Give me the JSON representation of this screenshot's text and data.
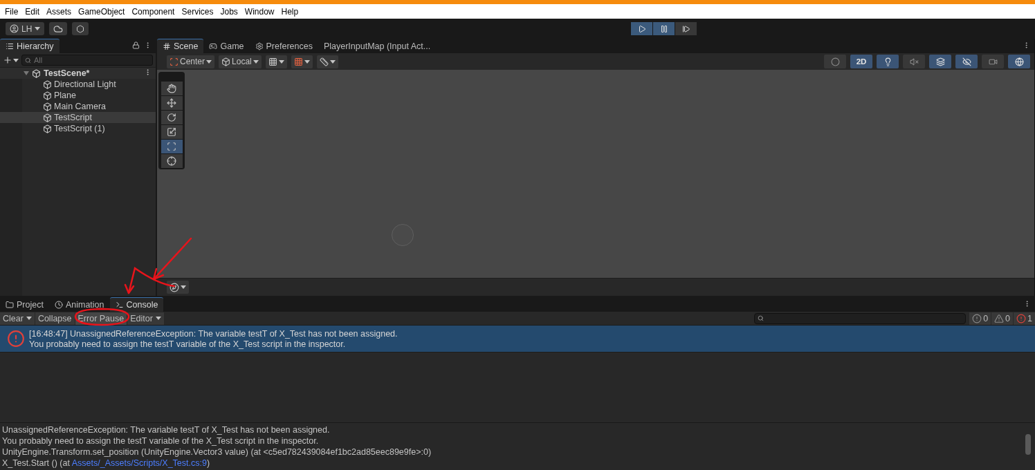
{
  "menu_bar": [
    "File",
    "Edit",
    "Assets",
    "GameObject",
    "Component",
    "Services",
    "Jobs",
    "Window",
    "Help"
  ],
  "toolbar": {
    "account": "LH"
  },
  "hierarchy": {
    "title": "Hierarchy",
    "search": {
      "placeholder": "All"
    },
    "scene": {
      "name": "TestScene*",
      "expanded": true,
      "children": [
        {
          "name": "Directional Light",
          "selected": false
        },
        {
          "name": "Plane",
          "selected": false
        },
        {
          "name": "Main Camera",
          "selected": false
        },
        {
          "name": "TestScript",
          "selected": true
        },
        {
          "name": "TestScript (1)",
          "selected": false
        }
      ]
    }
  },
  "scene_tabs": [
    {
      "kind": "scene",
      "label": "Scene",
      "selected": true
    },
    {
      "kind": "game",
      "label": "Game",
      "selected": false
    },
    {
      "kind": "preferences",
      "label": "Preferences",
      "selected": false
    },
    {
      "kind": "plain",
      "label": "PlayerInputMap (Input Act...",
      "selected": false
    }
  ],
  "scene_toolbar": {
    "pivot": "Center",
    "space": "Local"
  },
  "view_options": [
    {
      "kind": "shading",
      "on": false
    },
    {
      "kind": "mode",
      "label": "2D",
      "on": true
    },
    {
      "kind": "light",
      "on": true
    },
    {
      "kind": "audio",
      "on": false
    },
    {
      "kind": "effects",
      "on": true
    },
    {
      "kind": "visibility",
      "on": true
    },
    {
      "kind": "camera",
      "on": false
    },
    {
      "kind": "gizmos",
      "on": true
    }
  ],
  "tools": [
    {
      "kind": "hand",
      "selected": false
    },
    {
      "kind": "move",
      "selected": false
    },
    {
      "kind": "rotate",
      "selected": false
    },
    {
      "kind": "scale",
      "selected": false
    },
    {
      "kind": "rect",
      "selected": true
    },
    {
      "kind": "transform",
      "selected": false
    }
  ],
  "bottom_tabs": [
    {
      "kind": "project",
      "label": "Project",
      "selected": false
    },
    {
      "kind": "animation",
      "label": "Animation",
      "selected": false
    },
    {
      "kind": "console",
      "label": "Console",
      "selected": true
    }
  ],
  "console_toolbar": {
    "buttons": [
      {
        "kind": "split",
        "label": "Clear",
        "on": false
      },
      {
        "kind": "toggle",
        "label": "Collapse",
        "on": false
      },
      {
        "kind": "toggle",
        "label": "Error Pause",
        "on": true
      },
      {
        "kind": "dropdown",
        "label": "Editor",
        "on": false
      }
    ],
    "counts": [
      {
        "kind": "info",
        "count": "0"
      },
      {
        "kind": "warning",
        "count": "0"
      },
      {
        "kind": "error",
        "count": "1"
      }
    ]
  },
  "log": [
    {
      "kind": "error",
      "selected": true,
      "lines": [
        "[16:48:47] UnassignedReferenceException: The variable testT of X_Test has not been assigned.",
        "You probably need to assign the testT variable of the X_Test script in the inspector."
      ]
    }
  ],
  "details": {
    "lines": [
      "UnassignedReferenceException: The variable testT of X_Test has not been assigned.",
      "You probably need to assign the testT variable of the X_Test script in the inspector.",
      "UnityEngine.Transform.set_position (UnityEngine.Vector3 value) (at <c5ed782439084ef1bc2ad85eec89e9fe>:0)"
    ],
    "trace": {
      "before": "X_Test.Start () (at ",
      "link": "Assets/_Assets/Scripts/X_Test.cs:9",
      "after": ")"
    }
  }
}
